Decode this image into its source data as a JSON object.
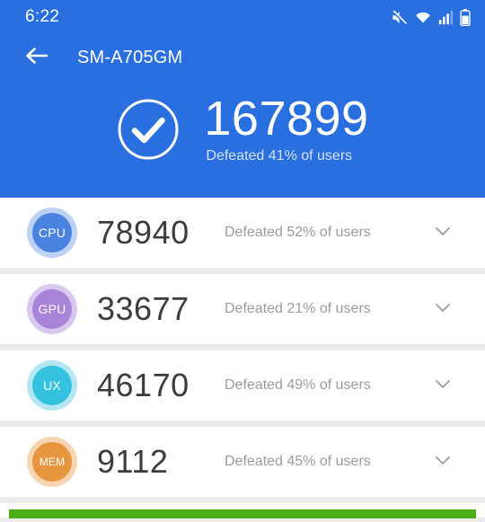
{
  "status_bar": {
    "time": "6:22",
    "icons": [
      "mute-icon",
      "wifi-icon",
      "signal-icon",
      "battery-icon"
    ]
  },
  "app_bar": {
    "back_icon": "back-arrow-icon",
    "title": "SM-A705GM"
  },
  "summary": {
    "check_icon": "check-circle-icon",
    "total_score": "167899",
    "defeated_text": "Defeated 41% of users"
  },
  "colors": {
    "header_blue": "#2a6fe0",
    "page_background": "#ebebeb",
    "card_white": "#ffffff",
    "score_text": "#3c3c3c",
    "sub_text": "#9b9b9b",
    "progress_green": "#4caf18"
  },
  "rows": [
    {
      "label": "CPU",
      "score": "78940",
      "defeated_text": "Defeated 52% of users",
      "badge_color": "#4a82e0",
      "badge_ring": "#bdd2f2",
      "expand_icon": "chevron-down-icon"
    },
    {
      "label": "GPU",
      "score": "33677",
      "defeated_text": "Defeated 21% of users",
      "badge_color": "#a884d8",
      "badge_ring": "#d9c9ee",
      "expand_icon": "chevron-down-icon"
    },
    {
      "label": "UX",
      "score": "46170",
      "defeated_text": "Defeated 49% of users",
      "badge_color": "#35c2e0",
      "badge_ring": "#b5e7f3",
      "expand_icon": "chevron-down-icon"
    },
    {
      "label": "MEM",
      "score": "9112",
      "defeated_text": "Defeated 45% of users",
      "badge_color": "#e8953f",
      "badge_ring": "#f6d5b0",
      "expand_icon": "chevron-down-icon"
    }
  ],
  "bottom_card": {
    "progress_color": "#4caf18"
  }
}
